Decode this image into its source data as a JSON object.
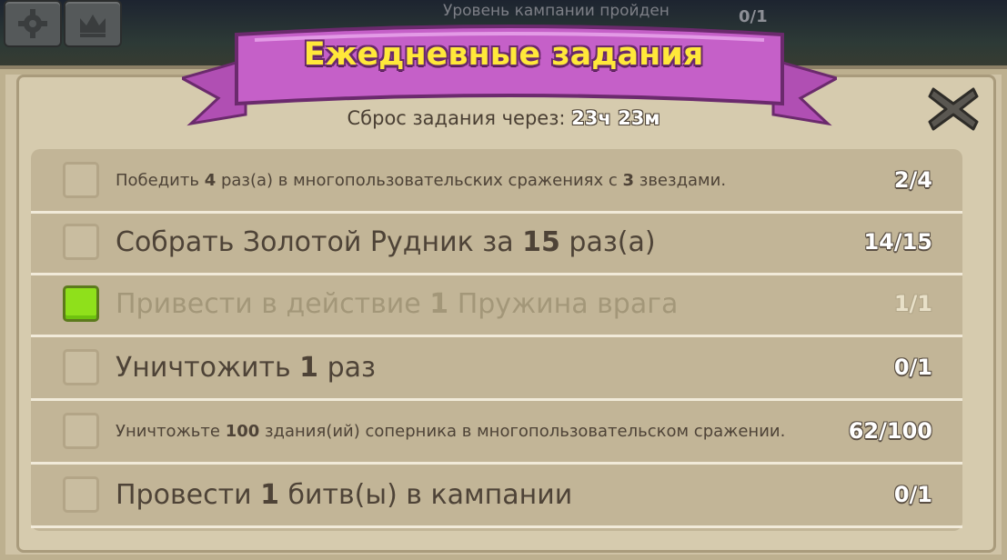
{
  "background": {
    "campaign_text": "Уровень кампании пройден",
    "campaign_count": "0/1"
  },
  "header": {
    "title": "Ежедневные задания",
    "reset_label": "Сброс задания через:",
    "reset_time": "23ч 23м"
  },
  "colors": {
    "ribbon": "#c560c8",
    "title": "#ffe83a",
    "done_checkbox": "#8fe01b",
    "panel": "#cfc3a6"
  },
  "tasks": [
    {
      "p1": "Победить ",
      "n": "4",
      "p2": " раз(а) в многопользовательских сражениях с ",
      "n2": "3",
      "p3": " звездами.",
      "progress": "2/4"
    },
    {
      "p1": "Собрать Золотой Рудник за ",
      "n": "15",
      "p2": " раз(а)",
      "progress": "14/15"
    },
    {
      "p1": "Привести в действие ",
      "n": "1",
      "p2": " Пружина врага",
      "progress": "1/1",
      "done": true
    },
    {
      "p1": "Уничтожить ",
      "n": "1",
      "p2": " раз",
      "progress": "0/1"
    },
    {
      "p1": "Уничтожьте ",
      "n": "100",
      "p2": " здания(ий) соперника в многопользовательском сражении.",
      "progress": "62/100"
    },
    {
      "p1": "Провести ",
      "n": "1",
      "p2": " битв(ы) в кампании",
      "progress": "0/1"
    }
  ]
}
